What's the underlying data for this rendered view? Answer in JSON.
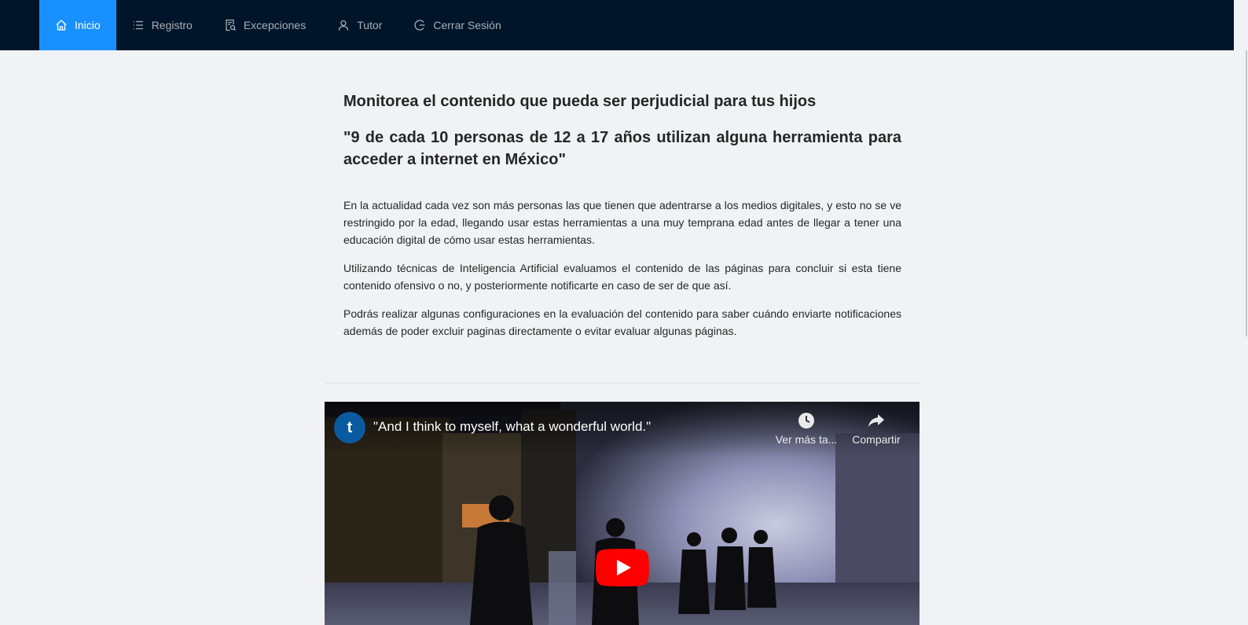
{
  "nav": {
    "items": [
      {
        "label": "Inicio",
        "icon": "home-icon",
        "active": true
      },
      {
        "label": "Registro",
        "icon": "list-icon",
        "active": false
      },
      {
        "label": "Excepciones",
        "icon": "file-search-icon",
        "active": false
      },
      {
        "label": "Tutor",
        "icon": "user-icon",
        "active": false
      },
      {
        "label": "Cerrar Sesión",
        "icon": "logout-icon",
        "active": false
      }
    ]
  },
  "main": {
    "heading": "Monitorea el contenido que pueda ser perjudicial para tus hijos",
    "quote": "\"9 de cada 10 personas de 12 a 17 años utilizan alguna herramienta para acceder a internet en México\"",
    "paragraphs": [
      "En la actualidad cada vez son más personas las que tienen que adentrarse a los medios digitales, y esto no se ve restringido por la edad, llegando usar estas herramientas a una muy temprana edad antes de llegar a tener una educación digital de cómo usar estas herramientas.",
      "Utilizando técnicas de Inteligencia Artificial evaluamos el contenido de las páginas para concluir si esta tiene contenido ofensivo o no, y posteriormente notificarte en caso de ser de que así.",
      "Podrás realizar algunas configuraciones en la evaluación del contenido para saber cuándo enviarte notificaciones además de poder excluir paginas directamente o evitar evaluar algunas páginas."
    ]
  },
  "video": {
    "channel_initial": "t",
    "title": "\"And I think to myself, what a wonderful world.\"",
    "watch_later_label": "Ver más ta...",
    "share_label": "Compartir",
    "play_color": "#ff0000"
  },
  "colors": {
    "nav_bg": "#001529",
    "nav_active": "#1890ff",
    "page_bg": "#f0f2f5"
  }
}
